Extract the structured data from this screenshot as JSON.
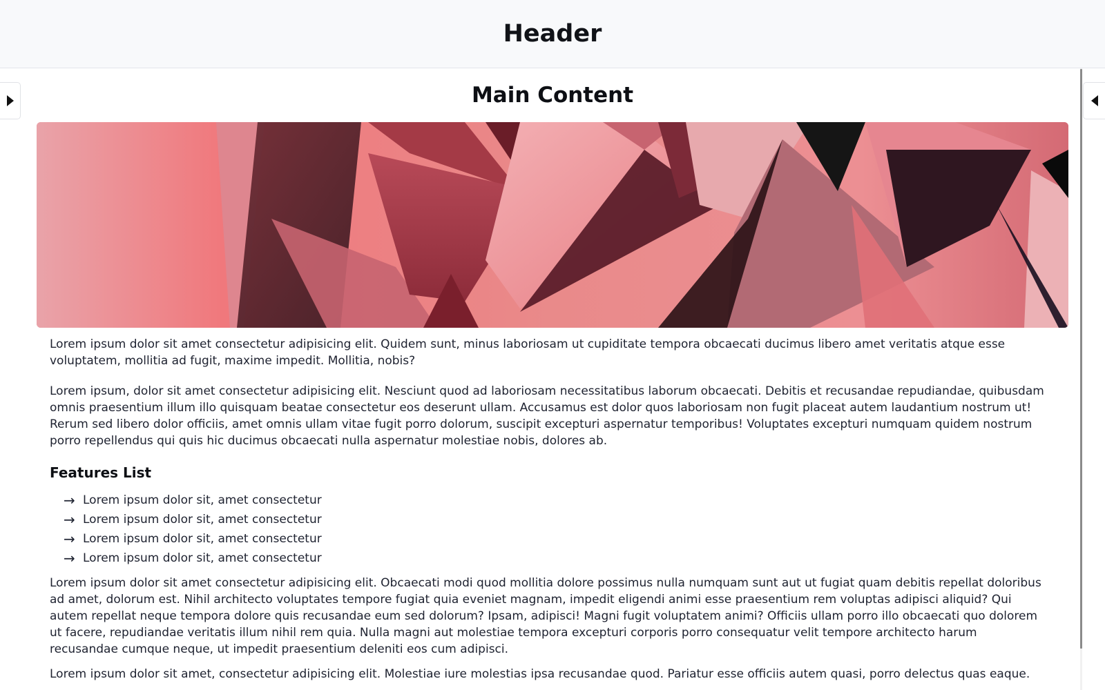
{
  "header": {
    "title": "Header"
  },
  "main": {
    "title": "Main Content",
    "banner_image": "abstract-red-polygon-banner",
    "paragraphs": [
      "Lorem ipsum dolor sit amet consectetur adipisicing elit. Quidem sunt, minus laboriosam ut cupiditate tempora obcaecati ducimus libero amet veritatis atque esse voluptatem, mollitia ad fugit, maxime impedit. Mollitia, nobis?",
      "Lorem ipsum, dolor sit amet consectetur adipisicing elit. Nesciunt quod ad laboriosam necessitatibus laborum obcaecati. Debitis et recusandae repudiandae, quibusdam omnis praesentium illum illo quisquam beatae consectetur eos deserunt ullam. Accusamus est dolor quos laboriosam non fugit placeat autem laudantium nostrum ut! Rerum sed libero dolor officiis, amet omnis ullam vitae fugit porro dolorum, suscipit excepturi aspernatur temporibus! Voluptates excepturi numquam quidem nostrum porro repellendus qui quis hic ducimus obcaecati nulla aspernatur molestiae nobis, dolores ab.",
      "Lorem ipsum dolor sit amet consectetur adipisicing elit. Obcaecati modi quod mollitia dolore possimus nulla numquam sunt aut ut fugiat quam debitis repellat doloribus ad amet, dolorum est. Nihil architecto voluptates tempore fugiat quia eveniet magnam, impedit eligendi animi esse praesentium rem voluptas adipisci aliquid? Qui autem repellat neque tempora dolore quis recusandae eum sed dolorum? Ipsam, adipisci! Magni fugit voluptatem animi? Officiis ullam porro illo obcaecati quo dolorem ut facere, repudiandae veritatis illum nihil rem quia. Nulla magni aut molestiae tempora excepturi corporis porro consequatur velit tempore architecto harum recusandae cumque neque, ut impedit praesentium deleniti eos cum adipisci.",
      "Lorem ipsum dolor sit amet, consectetur adipisicing elit. Molestiae iure molestias ipsa recusandae quod. Pariatur esse officiis autem quasi, porro delectus quas eaque."
    ],
    "features": {
      "title": "Features List",
      "items": [
        "Lorem ipsum dolor sit, amet consectetur",
        "Lorem ipsum dolor sit, amet consectetur",
        "Lorem ipsum dolor sit, amet consectetur",
        "Lorem ipsum dolor sit, amet consectetur"
      ],
      "bullet_icon": "arrow-right-icon"
    }
  },
  "sidebar_toggles": {
    "left_icon": "caret-right-icon",
    "right_icon": "caret-left-icon"
  }
}
